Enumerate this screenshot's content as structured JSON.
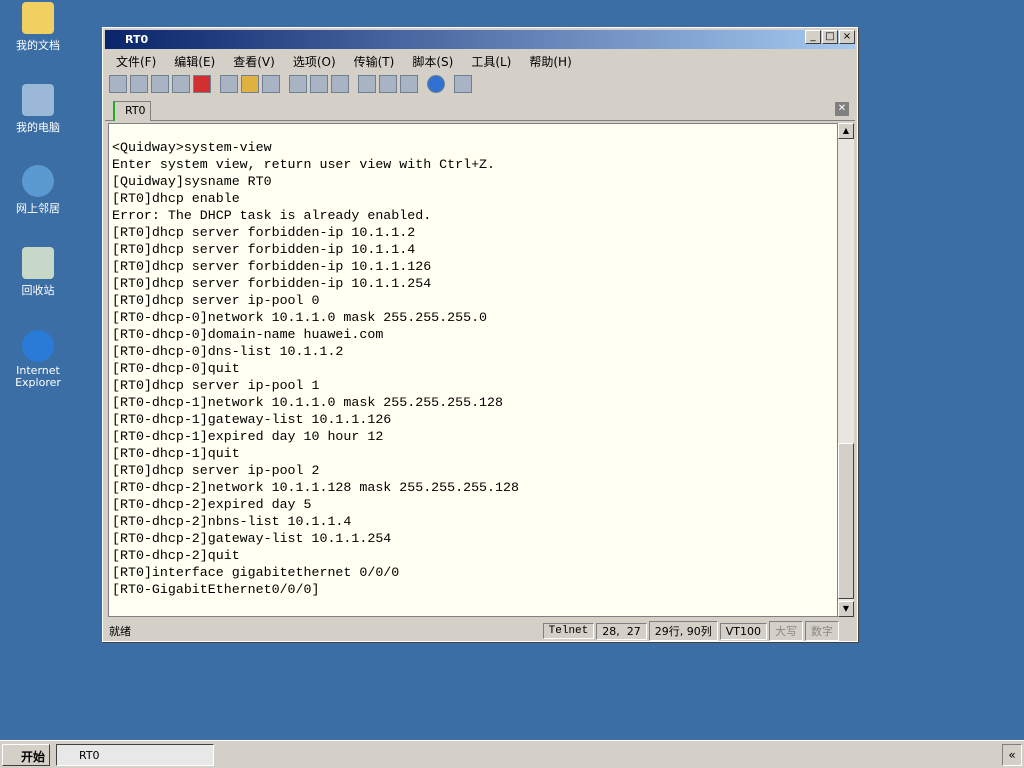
{
  "desktop": {
    "icons": [
      {
        "label": "我的文档"
      },
      {
        "label": "我的电脑"
      },
      {
        "label": "网上邻居"
      },
      {
        "label": "回收站"
      },
      {
        "label": "Internet Explorer"
      }
    ]
  },
  "window": {
    "title": "RT0",
    "menu": [
      "文件(F)",
      "编辑(E)",
      "查看(V)",
      "选项(O)",
      "传输(T)",
      "脚本(S)",
      "工具(L)",
      "帮助(H)"
    ],
    "tab": "RT0"
  },
  "terminal": {
    "lines": [
      "<Quidway>system-view",
      "Enter system view, return user view with Ctrl+Z.",
      "[Quidway]sysname RT0",
      "[RT0]dhcp enable",
      "Error: The DHCP task is already enabled.",
      "[RT0]dhcp server forbidden-ip 10.1.1.2",
      "[RT0]dhcp server forbidden-ip 10.1.1.4",
      "[RT0]dhcp server forbidden-ip 10.1.1.126",
      "[RT0]dhcp server forbidden-ip 10.1.1.254",
      "[RT0]dhcp server ip-pool 0",
      "[RT0-dhcp-0]network 10.1.1.0 mask 255.255.255.0",
      "[RT0-dhcp-0]domain-name huawei.com",
      "[RT0-dhcp-0]dns-list 10.1.1.2",
      "[RT0-dhcp-0]quit",
      "[RT0]dhcp server ip-pool 1",
      "[RT0-dhcp-1]network 10.1.1.0 mask 255.255.255.128",
      "[RT0-dhcp-1]gateway-list 10.1.1.126",
      "[RT0-dhcp-1]expired day 10 hour 12",
      "[RT0-dhcp-1]quit",
      "[RT0]dhcp server ip-pool 2",
      "[RT0-dhcp-2]network 10.1.1.128 mask 255.255.255.128",
      "[RT0-dhcp-2]expired day 5",
      "[RT0-dhcp-2]nbns-list 10.1.1.4",
      "[RT0-dhcp-2]gateway-list 10.1.1.254",
      "[RT0-dhcp-2]quit",
      "[RT0]interface gigabitethernet 0/0/0",
      "[RT0-GigabitEthernet0/0/0]"
    ]
  },
  "status": {
    "ready": "就绪",
    "protocol": "Telnet",
    "cursor": "28,  27",
    "size": "29行, 90列",
    "emulation": "VT100",
    "caps": "大写",
    "num": "数字"
  },
  "taskbar": {
    "start": "开始",
    "task": "RT0",
    "tray": "«"
  }
}
